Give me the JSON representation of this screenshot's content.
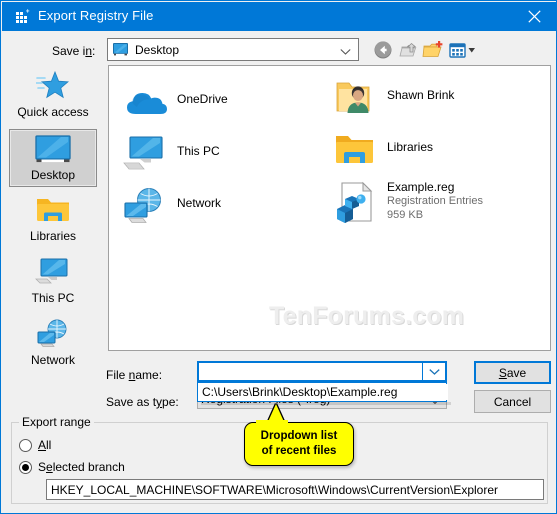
{
  "window": {
    "title": "Export Registry File",
    "icon": "registry-editor-icon",
    "close_label": "✕"
  },
  "toolbar": {
    "savein_label": "Save in:",
    "savein_value": "Desktop",
    "buttons": [
      {
        "name": "back-button",
        "tooltip": "Back"
      },
      {
        "name": "up-one-level-button",
        "tooltip": "Up One Level"
      },
      {
        "name": "new-folder-button",
        "tooltip": "Create New Folder"
      },
      {
        "name": "views-button",
        "tooltip": "Views"
      }
    ]
  },
  "places_bar": {
    "items": [
      {
        "label": "Quick access",
        "icon": "quick-access-icon",
        "selected": false
      },
      {
        "label": "Desktop",
        "icon": "desktop-icon",
        "selected": true
      },
      {
        "label": "Libraries",
        "icon": "libraries-folder-icon",
        "selected": false
      },
      {
        "label": "This PC",
        "icon": "this-pc-icon",
        "selected": false
      },
      {
        "label": "Network",
        "icon": "network-icon",
        "selected": false
      }
    ]
  },
  "file_list": {
    "watermark": "TenForums.com",
    "items": [
      {
        "name": "OneDrive",
        "icon": "onedrive-icon",
        "type": "",
        "size": ""
      },
      {
        "name": "This PC",
        "icon": "this-pc-icon",
        "type": "",
        "size": ""
      },
      {
        "name": "Network",
        "icon": "network-icon",
        "type": "",
        "size": ""
      },
      {
        "name": "Shawn Brink",
        "icon": "user-folder-icon",
        "type": "",
        "size": ""
      },
      {
        "name": "Libraries",
        "icon": "libraries-folder-icon",
        "type": "",
        "size": ""
      },
      {
        "name": "Example.reg",
        "icon": "reg-file-icon",
        "type": "Registration Entries",
        "size": "959 KB"
      }
    ]
  },
  "form": {
    "filename_label": "File name:",
    "filename_value": "",
    "filename_placeholder": "",
    "savetype_label": "Save as type:",
    "savetype_value": "Registration Files (*.reg)",
    "dropdown": {
      "items": [
        "C:\\Users\\Brink\\Desktop\\Example.reg"
      ]
    },
    "save_button": "Save",
    "save_button_accesskey": "S",
    "cancel_button": "Cancel"
  },
  "export_range": {
    "legend": "Export range",
    "options": [
      {
        "label": "All",
        "checked": false
      },
      {
        "label": "Selected branch",
        "checked": true
      }
    ],
    "branch_value": "HKEY_LOCAL_MACHINE\\SOFTWARE\\Microsoft\\Windows\\CurrentVersion\\Explorer"
  },
  "callout": {
    "line1": "Dropdown list",
    "line2": "of recent files"
  },
  "colors": {
    "titlebar": "#0078d7",
    "accent": "#0078d7",
    "dialog_bg": "#f0f0f0",
    "callout_bg": "#ffff00"
  }
}
